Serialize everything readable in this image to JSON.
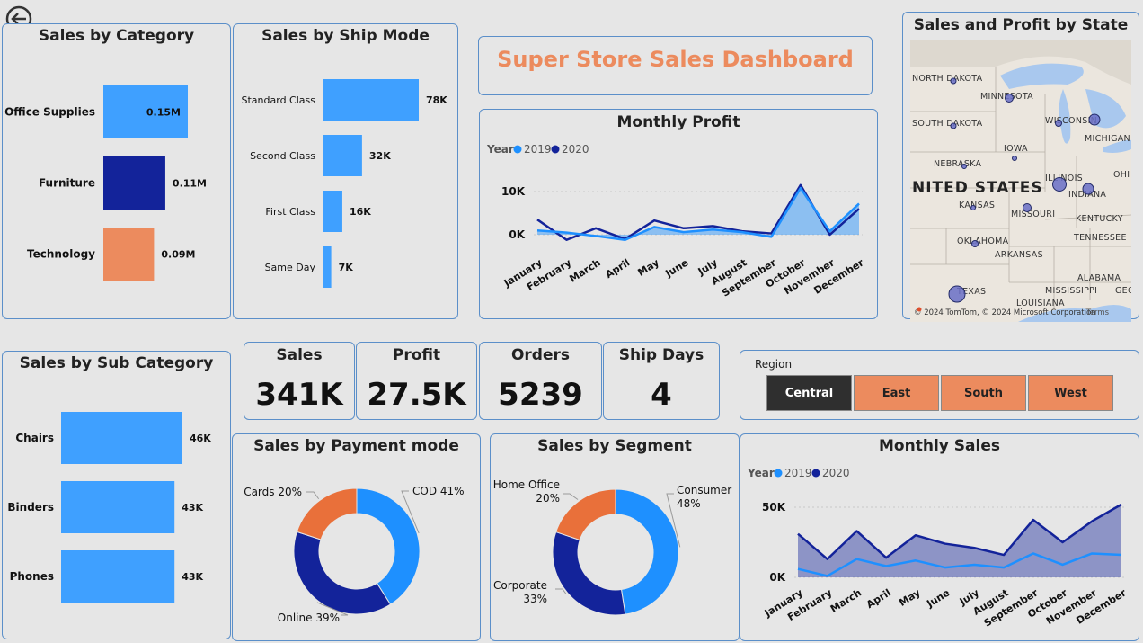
{
  "dashboard_title": "Super Store Sales Dashboard",
  "colors": {
    "c2019": "#1e90ff",
    "c2020": "#13239a",
    "light_blue": "#3fa0ff",
    "dark_blue": "#13239a",
    "orange": "#ec8b5e",
    "donut_orange": "#e9703a"
  },
  "icons": {
    "back": "back-arrow-icon"
  },
  "kpis": [
    {
      "label": "Sales",
      "value": "341K"
    },
    {
      "label": "Profit",
      "value": "27.5K"
    },
    {
      "label": "Orders",
      "value": "5239"
    },
    {
      "label": "Ship Days",
      "value": "4"
    }
  ],
  "region": {
    "title": "Region",
    "options": [
      "Central",
      "East",
      "South",
      "West"
    ],
    "selected": "Central"
  },
  "map": {
    "title": "Sales and Profit by State",
    "country_label": "NITED STATES",
    "state_labels": [
      "NORTH DAKOTA",
      "MINNESOTA",
      "SOUTH DAKOTA",
      "WISCONSIN",
      "MICHIGAN",
      "IOWA",
      "NEBRASKA",
      "ILLINOIS",
      "INDIANA",
      "OHI",
      "KANSAS",
      "MISSOURI",
      "KENTUCKY",
      "OKLAHOMA",
      "TENNESSEE",
      "ARKANSAS",
      "ALABAMA",
      "MISSISSIPPI",
      "GEORGI",
      "TEXAS",
      "LOUISIANA"
    ],
    "attribution": "© 2024 TomTom, © 2024 Microsoft Corporation",
    "terms": "Terms"
  },
  "chart_data": [
    {
      "type": "bar",
      "orientation": "horizontal",
      "title": "Sales by Category",
      "categories": [
        "Office Supplies",
        "Furniture",
        "Technology"
      ],
      "values": [
        0.15,
        0.11,
        0.09
      ],
      "labels": [
        "0.15M",
        "0.11M",
        "0.09M"
      ],
      "colors": [
        "#3fa0ff",
        "#13239a",
        "#ec8b5e"
      ]
    },
    {
      "type": "bar",
      "orientation": "horizontal",
      "title": "Sales by Ship Mode",
      "categories": [
        "Standard Class",
        "Second Class",
        "First Class",
        "Same Day"
      ],
      "values": [
        78,
        32,
        16,
        7
      ],
      "labels": [
        "78K",
        "32K",
        "16K",
        "7K"
      ]
    },
    {
      "type": "area",
      "title": "Monthly Profit",
      "legend_title": "Year",
      "x": [
        "January",
        "February",
        "March",
        "April",
        "May",
        "June",
        "July",
        "August",
        "September",
        "October",
        "November",
        "December"
      ],
      "yticks": [
        "0K",
        "10K"
      ],
      "ylim": [
        -2,
        11
      ],
      "series": [
        {
          "name": "2019",
          "values": [
            1.0,
            0.5,
            -0.3,
            -1.2,
            1.8,
            0.6,
            1.2,
            0.6,
            -0.5,
            10.8,
            0.8,
            7.2
          ]
        },
        {
          "name": "2020",
          "values": [
            3.5,
            -1.2,
            1.5,
            -1.0,
            3.3,
            1.5,
            2.0,
            0.8,
            0.3,
            11.5,
            0.0,
            6.0
          ]
        }
      ]
    },
    {
      "type": "bar",
      "orientation": "horizontal",
      "title": "Sales by Sub Category",
      "categories": [
        "Chairs",
        "Binders",
        "Phones"
      ],
      "values": [
        46,
        43,
        43
      ],
      "labels": [
        "46K",
        "43K",
        "43K"
      ]
    },
    {
      "type": "pie",
      "donut": true,
      "title": "Sales by Payment mode",
      "slices": [
        {
          "name": "COD",
          "value": 41,
          "label": "COD 41%"
        },
        {
          "name": "Online",
          "value": 39,
          "label": "Online 39%"
        },
        {
          "name": "Cards",
          "value": 20,
          "label": "Cards 20%"
        }
      ]
    },
    {
      "type": "pie",
      "donut": true,
      "title": "Sales by Segment",
      "slices": [
        {
          "name": "Consumer",
          "value": 48,
          "label": [
            "Consumer",
            "48%"
          ]
        },
        {
          "name": "Corporate",
          "value": 33,
          "label": [
            "Corporate",
            "33%"
          ]
        },
        {
          "name": "Home Office",
          "value": 20,
          "label": [
            "Home Office",
            "20%"
          ]
        }
      ]
    },
    {
      "type": "area",
      "title": "Monthly Sales",
      "legend_title": "Year",
      "x": [
        "January",
        "February",
        "March",
        "April",
        "May",
        "June",
        "July",
        "August",
        "September",
        "October",
        "November",
        "December"
      ],
      "yticks": [
        "0K",
        "50K"
      ],
      "ylim": [
        0,
        55
      ],
      "series": [
        {
          "name": "2019",
          "values": [
            6,
            1,
            13,
            8,
            12,
            7,
            9,
            7,
            17,
            9,
            17,
            16
          ]
        },
        {
          "name": "2020",
          "values": [
            31,
            13,
            33,
            14,
            30,
            24,
            21,
            16,
            41,
            25,
            40,
            52
          ]
        }
      ]
    }
  ]
}
